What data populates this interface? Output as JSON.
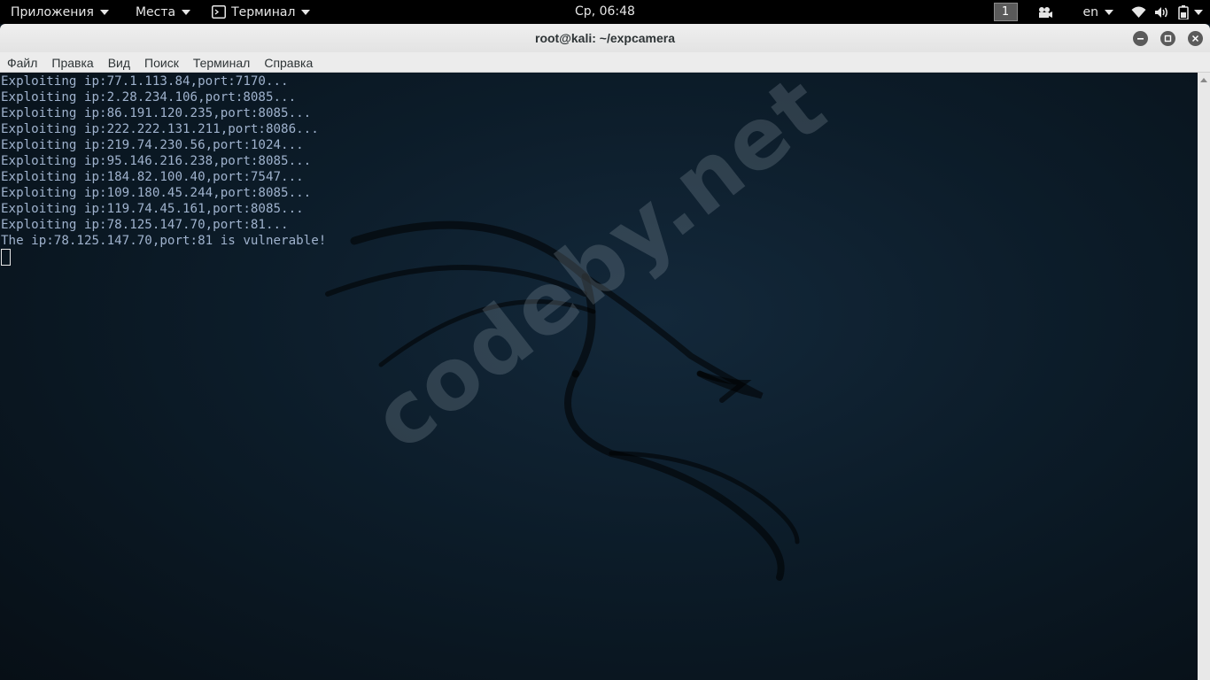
{
  "top_panel": {
    "apps_menu": "Приложения",
    "places_menu": "Места",
    "active_app": "Терминал",
    "clock": "Ср, 06:48",
    "workspace": "1",
    "keyboard_layout": "en",
    "icons": [
      "camera-icon",
      "wifi-icon",
      "volume-icon",
      "battery-icon"
    ]
  },
  "window": {
    "title": "root@kali: ~/expcamera",
    "menu": [
      "Файл",
      "Правка",
      "Вид",
      "Поиск",
      "Терминал",
      "Справка"
    ]
  },
  "terminal": {
    "lines": [
      "Exploiting ip:77.1.113.84,port:7170...",
      "Exploiting ip:2.28.234.106,port:8085...",
      "Exploiting ip:86.191.120.235,port:8085...",
      "Exploiting ip:222.222.131.211,port:8086...",
      "Exploiting ip:219.74.230.56,port:1024...",
      "Exploiting ip:95.146.216.238,port:8085...",
      "Exploiting ip:184.82.100.40,port:7547...",
      "Exploiting ip:109.180.45.244,port:8085...",
      "Exploiting ip:119.74.45.161,port:8085...",
      "Exploiting ip:78.125.147.70,port:81...",
      "The ip:78.125.147.70,port:81 is vulnerable!"
    ]
  },
  "watermark": "codeby.net",
  "colors": {
    "terminal_text": "#9fb2cd",
    "panel_bg": "#000000",
    "titlebar_bg": "#e8e8e8"
  }
}
